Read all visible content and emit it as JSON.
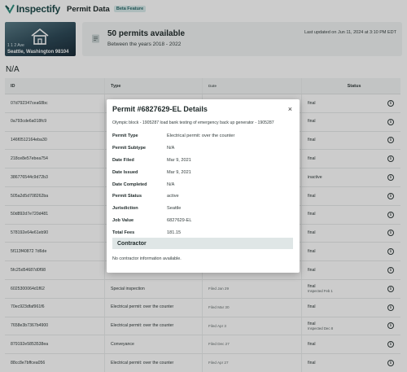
{
  "header": {
    "brand": "Inspectify",
    "page_title": "Permit Data",
    "badge": "Beta Feature"
  },
  "summary": {
    "address_line": "1 1 2 Ave",
    "city": "Seattle, Washington 98104",
    "count_text": "50 permits available",
    "years_text": "Between the years 2018 - 2022",
    "updated_text": "Last updated on Jun 11, 2024 at 3:10 PM EDT"
  },
  "address_header": "N/A",
  "table": {
    "columns": [
      "ID",
      "Type",
      "Date",
      "Status"
    ],
    "rows": [
      {
        "id": "07d792347cea68bc",
        "type": "",
        "date": "",
        "status": "final",
        "status_sub": ""
      },
      {
        "id": "0a793cde6a018fc9",
        "type": "",
        "date": "",
        "status": "final",
        "status_sub": ""
      },
      {
        "id": "146f0512164eba30",
        "type": "",
        "date": "",
        "status": "final",
        "status_sub": ""
      },
      {
        "id": "218ce8e57ebea754",
        "type": "",
        "date": "",
        "status": "final",
        "status_sub": ""
      },
      {
        "id": "386776544c9d72b3",
        "type": "",
        "date": "",
        "status": "inactive",
        "status_sub": ""
      },
      {
        "id": "505a2d5d708262ba",
        "type": "",
        "date": "",
        "status": "final",
        "status_sub": ""
      },
      {
        "id": "50d892d7e720d481",
        "type": "",
        "date": "",
        "status": "final",
        "status_sub": ""
      },
      {
        "id": "578192e64e61eb90",
        "type": "",
        "date": "",
        "status": "final",
        "status_sub": ""
      },
      {
        "id": "5f113f40872 7d6de",
        "type": "",
        "date": "",
        "status": "final",
        "status_sub": ""
      },
      {
        "id": "5fc25d54687d0f98",
        "type": "",
        "date": "",
        "status": "final",
        "status_sub": ""
      },
      {
        "id": "6025300064d1f62",
        "type": "Special inspection",
        "date": "Filed Jan 29",
        "status": "final",
        "status_sub": "Inspected Feb 1"
      },
      {
        "id": "70ec923dfaf961f6",
        "type": "Electrical permit: over the counter",
        "date": "Filed Mar 30",
        "status": "final",
        "status_sub": ""
      },
      {
        "id": "7658e3b7367b4900",
        "type": "Electrical permit: over the counter",
        "date": "Filed Apr 3",
        "status": "final",
        "status_sub": "Inspected Dec 8"
      },
      {
        "id": "879192e5853538ea",
        "type": "Conveyance",
        "date": "Filed Dec 27",
        "status": "final",
        "status_sub": ""
      },
      {
        "id": "88cc8e7bffcea056",
        "type": "Electrical permit: over the counter",
        "date": "Filed Apr 27",
        "status": "final",
        "status_sub": ""
      }
    ]
  },
  "modal": {
    "title": "Permit #6827629-EL Details",
    "close": "×",
    "description": "Olympic block - 1905287 load bank testing of emergency back up generator - 1905287",
    "details": [
      {
        "label": "Permit Type",
        "value": "Electrical permit: over the counter"
      },
      {
        "label": "Permit Subtype",
        "value": "N/A"
      },
      {
        "label": "Date Filed",
        "value": "Mar 9, 2021"
      },
      {
        "label": "Date Issued",
        "value": "Mar 9, 2021"
      },
      {
        "label": "Date Completed",
        "value": "N/A"
      },
      {
        "label": "Permit Status",
        "value": "active"
      },
      {
        "label": "Jurisdiction",
        "value": "Seattle"
      },
      {
        "label": "Job Value",
        "value": "6827629-EL"
      },
      {
        "label": "Total Fees",
        "value": "181.15"
      }
    ],
    "contractor_header": "Contractor",
    "contractor_note": "No contractor information available."
  },
  "colors": {
    "brand": "#1e4a4a",
    "overlay": "rgba(0,0,0,0.2)",
    "contractor_bg": "#dfe6e6"
  }
}
